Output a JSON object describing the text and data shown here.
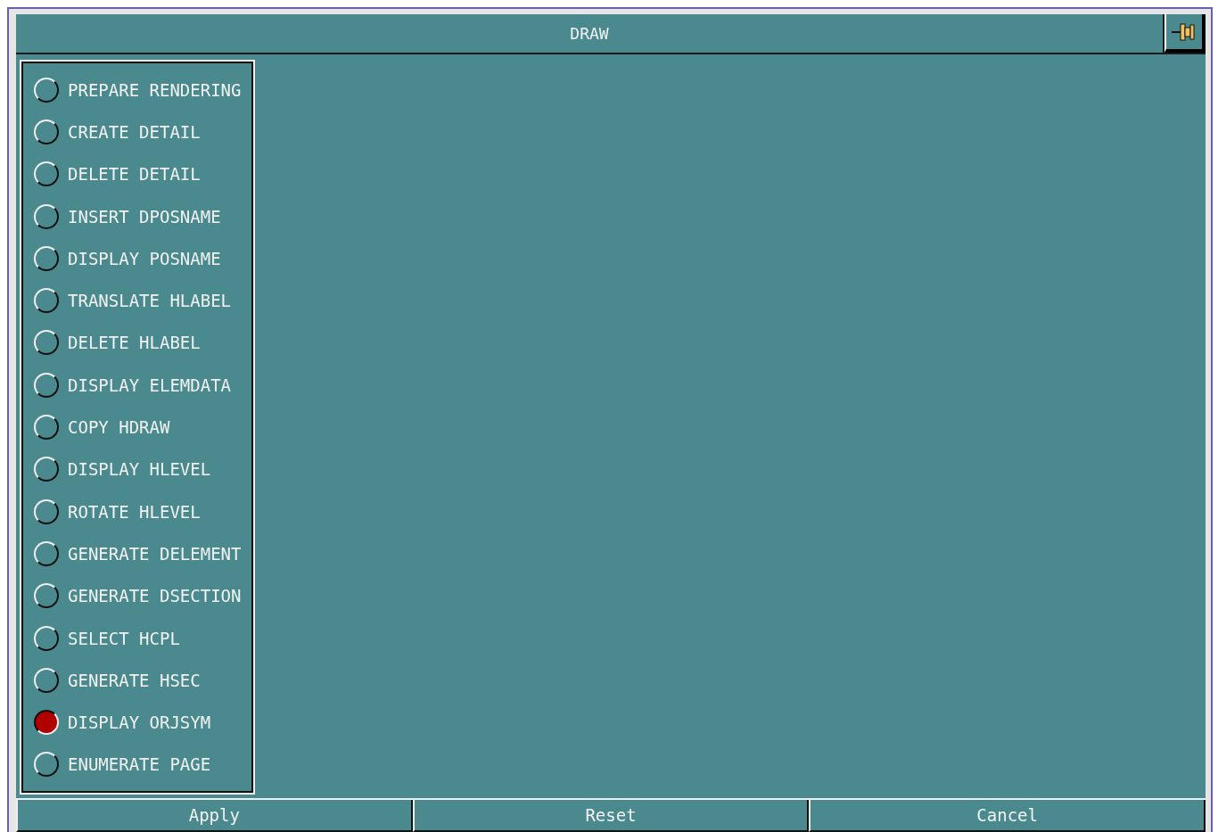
{
  "window": {
    "title": "DRAW"
  },
  "options": [
    {
      "label": "PREPARE RENDERING",
      "selected": false
    },
    {
      "label": "CREATE DETAIL",
      "selected": false
    },
    {
      "label": "DELETE DETAIL",
      "selected": false
    },
    {
      "label": "INSERT DPOSNAME",
      "selected": false
    },
    {
      "label": "DISPLAY POSNAME",
      "selected": false
    },
    {
      "label": "TRANSLATE HLABEL",
      "selected": false
    },
    {
      "label": "DELETE HLABEL",
      "selected": false
    },
    {
      "label": "DISPLAY ELEMDATA",
      "selected": false
    },
    {
      "label": "COPY HDRAW",
      "selected": false
    },
    {
      "label": "DISPLAY HLEVEL",
      "selected": false
    },
    {
      "label": "ROTATE HLEVEL",
      "selected": false
    },
    {
      "label": "GENERATE DELEMENT",
      "selected": false
    },
    {
      "label": "GENERATE DSECTION",
      "selected": false
    },
    {
      "label": "SELECT HCPL",
      "selected": false
    },
    {
      "label": "GENERATE HSEC",
      "selected": false
    },
    {
      "label": "DISPLAY ORJSYM",
      "selected": true
    },
    {
      "label": "ENUMERATE PAGE",
      "selected": false
    }
  ],
  "buttons": [
    "Apply",
    "Reset",
    "Cancel"
  ]
}
